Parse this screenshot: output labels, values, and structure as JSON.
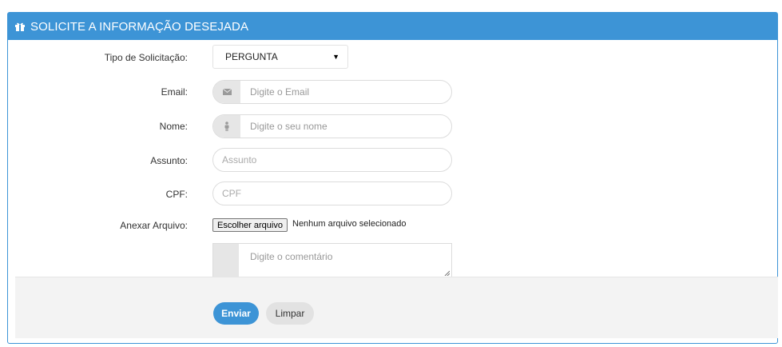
{
  "panel": {
    "title": "SOLICITE A INFORMAÇÃO DESEJADA",
    "header_icon": "gift-icon",
    "accent_color": "#3d94d6"
  },
  "form": {
    "tipo": {
      "label": "Tipo de Solicitação:",
      "value": "PERGUNTA"
    },
    "email": {
      "label": "Email:",
      "placeholder": "Digite o Email",
      "icon": "envelope-icon"
    },
    "nome": {
      "label": "Nome:",
      "placeholder": "Digite o seu nome",
      "icon": "person-icon"
    },
    "assunto": {
      "label": "Assunto:",
      "placeholder": "Assunto"
    },
    "cpf": {
      "label": "CPF:",
      "placeholder": "CPF"
    },
    "anexo": {
      "label": "Anexar Arquivo:",
      "button": "Escolher arquivo",
      "status": "Nenhum arquivo selecionado"
    },
    "comentario": {
      "placeholder": "Digite o comentário"
    }
  },
  "actions": {
    "submit_label": "Enviar",
    "clear_label": "Limpar"
  }
}
